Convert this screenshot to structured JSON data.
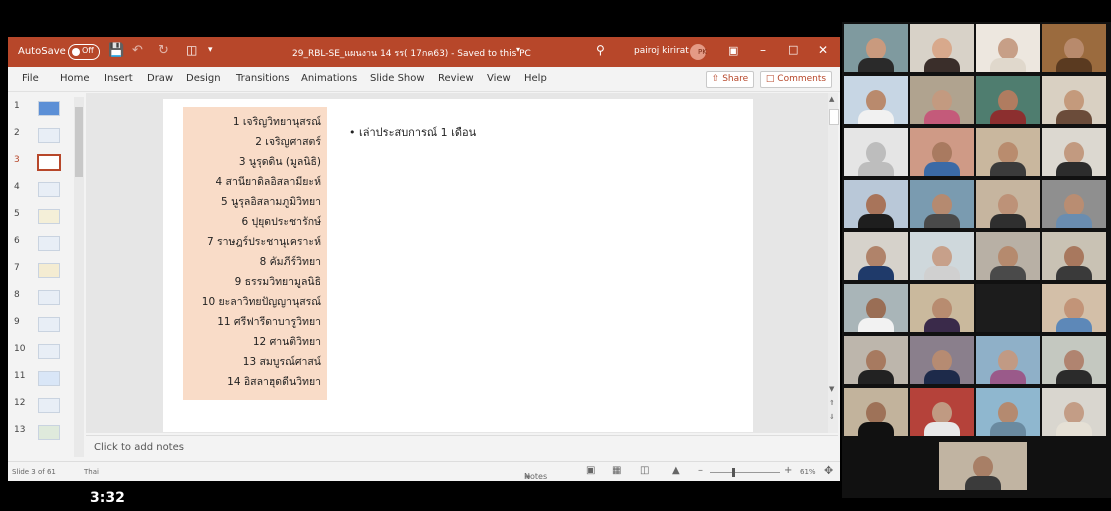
{
  "titlebar": {
    "autosave_label": "AutoSave",
    "autosave_state": "Off",
    "document_title": "29_RBL-SE_แผนงาน 14 รร( 17กค63) - Saved to this PC",
    "user_name": "pairoj kirirat",
    "user_initials": "PK"
  },
  "menu": {
    "items": [
      "File",
      "Home",
      "Insert",
      "Draw",
      "Design",
      "Transitions",
      "Animations",
      "Slide Show",
      "Review",
      "View",
      "Help"
    ],
    "share_label": "Share",
    "comments_label": "Comments"
  },
  "thumbnails": [
    "1",
    "2",
    "3",
    "4",
    "5",
    "6",
    "7",
    "8",
    "9",
    "10",
    "11",
    "12",
    "13"
  ],
  "active_slide": "3",
  "slide": {
    "schools": [
      "1 เจริญวิทยานุสรณ์",
      "2 เจริญศาสตร์",
      "3 นูรุดดิน (มูลนิธิ)",
      "4 สานียาดิลอิสลามียะห์",
      "5 นูรุลอิสลามภูมิวิทยา",
      "6 ปุยุดประชารักษ์",
      "7 ราษฎร์ประชานุเคราะห์",
      "8 คัมภีร์วิทยา",
      "9 ธรรมวิทยามูลนิธิ",
      "10 ยะลาวิทยปัญญานุสรณ์",
      "11 ศรีฟารีดาบารูวิทยา",
      "12 ศานติวิทยา",
      "13 สมบูรณ์ศาสน์",
      "14 อิสลาฮุดดีนวิทยา"
    ],
    "bullet": "เล่าประสบการณ์ 1 เดือน"
  },
  "notes": {
    "placeholder": "Click to add notes"
  },
  "status": {
    "slide_count": "Slide 3 of 61",
    "language": "Thai",
    "notes_label": "Notes",
    "zoom": "61%"
  },
  "video_timer": "3:32",
  "colors": {
    "accent": "#b7472a",
    "highlight": "#f9dcc8"
  }
}
